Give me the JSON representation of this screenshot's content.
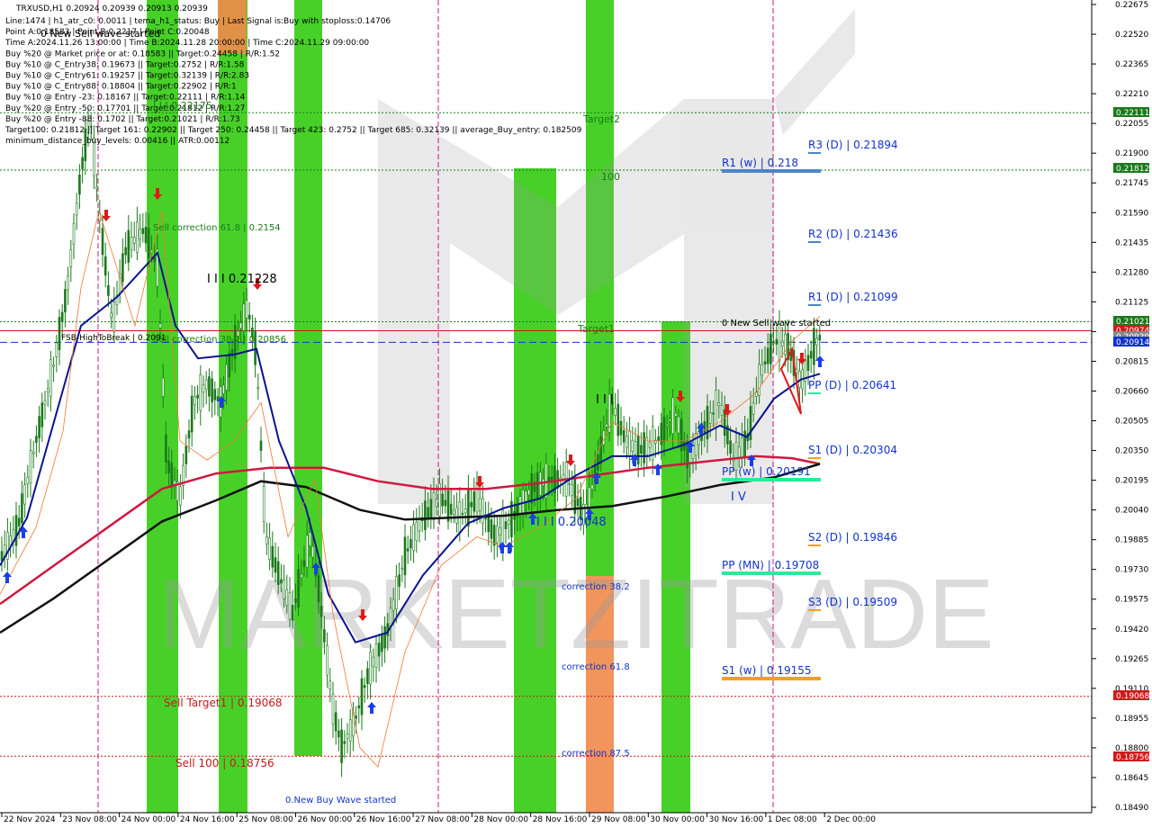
{
  "window": {
    "title": "TRXUSD,H1  0.20924 0.20939 0.20913 0.20939"
  },
  "info_lines": [
    "Line:1474 | h1_atr_c0: 0.0011 | tema_h1_status: Buy | Last Signal is:Buy with stoploss:0.14706",
    "Point A:0.18583 | Point B:0.2217 | Point C:0.20048",
    "Time A:2024.11.26 13:00:00 | Time B:2024.11.28 20:00:00 | Time C:2024.11.29 09:00:00",
    "Buy %20 @ Market price or at: 0.18583 || Target:0.24458 | R/R:1.52",
    "Buy %10 @ C_Entry38: 0.19673 || Target:0.2752 | R/R:1.58",
    "Buy %10 @ C_Entry61: 0.19257 || Target:0.32139 | R/R:2.83",
    "Buy %10 @ C_Entry88: 0.18804 || Target:0.22902 | R/R:1",
    "Buy %10 @ Entry -23: 0.18167 || Target:0.22111 | R/R:1.14",
    "Buy %20 @ Entry -50: 0.17701 || Target:0.21812 | R/R:1.27",
    "Buy %20 @ Entry -88: 0.1702 || Target:0.21021 | R/R:1.73",
    "Target100: 0.21812 || Target 161: 0.22902 || Target 250: 0.24458 || Target 423: 0.2752 || Target 685: 0.32139 || average_Buy_entry: 0.182509",
    "minimum_distance_buy_levels: 0.00416 || ATR:0.00112"
  ],
  "price_axis": {
    "ticks": [
      "0.22675",
      "0.22520",
      "0.22365",
      "0.22210",
      "0.22055",
      "0.21900",
      "0.21745",
      "0.21590",
      "0.21435",
      "0.21280",
      "0.21125",
      "0.20970",
      "0.20815",
      "0.20660",
      "0.20505",
      "0.20350",
      "0.20195",
      "0.20040",
      "0.19885",
      "0.19730",
      "0.19575",
      "0.19420",
      "0.19265",
      "0.19110",
      "0.18955",
      "0.18800",
      "0.18645",
      "0.18490"
    ],
    "boxes": [
      {
        "label": "0.22111",
        "color": "#1b7a1b"
      },
      {
        "label": "0.21812",
        "color": "#1b7a1b"
      },
      {
        "label": "0.21021",
        "color": "#1b7a1b"
      },
      {
        "label": "0.20974",
        "color": "#d11a1a"
      },
      {
        "label": "0.20939",
        "color": "#888888"
      },
      {
        "label": "0.20914",
        "color": "#1133cc"
      },
      {
        "label": "0.19068",
        "color": "#d11a1a"
      },
      {
        "label": "0.18756",
        "color": "#d11a1a"
      }
    ]
  },
  "time_axis": [
    "22 Nov 2024",
    "23 Nov 08:00",
    "24 Nov 00:00",
    "24 Nov 16:00",
    "25 Nov 08:00",
    "26 Nov 00:00",
    "26 Nov 16:00",
    "27 Nov 08:00",
    "28 Nov 00:00",
    "28 Nov 16:00",
    "29 Nov 08:00",
    "30 Nov 00:00",
    "30 Nov 16:00",
    "1 Dec 08:00",
    "2 Dec 00:00"
  ],
  "pivots": [
    {
      "label": "R3 (D) | 0.21894",
      "color": "#1133cc",
      "tick": "#4a86c8"
    },
    {
      "label": "R1 (w) | 0.218",
      "color": "#1133cc",
      "tick": "#4a86c8",
      "bold": true
    },
    {
      "label": "R2 (D) | 0.21436",
      "color": "#1133cc",
      "tick": "#4a86c8"
    },
    {
      "label": "R1 (D) | 0.21099",
      "color": "#1133cc",
      "tick": "#4a86c8"
    },
    {
      "label": "PP (D) | 0.20641",
      "color": "#1133cc",
      "tick": "#2ee89a"
    },
    {
      "label": "S1 (D) | 0.20304",
      "color": "#1133cc",
      "tick": "#f0a020"
    },
    {
      "label": "PP (w) | 0.20191",
      "color": "#1133cc",
      "tick": "#2ee89a",
      "bold": true
    },
    {
      "label": "S2 (D) | 0.19846",
      "color": "#1133cc",
      "tick": "#f0a020"
    },
    {
      "label": "PP (MN) | 0.19708",
      "color": "#1133cc",
      "tick": "#2ee89a",
      "bold": true
    },
    {
      "label": "S3 (D) | 0.19509",
      "color": "#1133cc",
      "tick": "#f0a020"
    },
    {
      "label": "S1 (w) | 0.19155",
      "color": "#1133cc",
      "tick": "#f0a020",
      "bold": true
    }
  ],
  "annotations": {
    "sell_wave_top": "0 New Sell wave started",
    "sell_wave_right": "0 New Sell wave started",
    "buy_wave": "0.New Buy Wave started",
    "sell_correction": "Sell correction 61.8 | 0.2154",
    "sell_correction_38": "Sell correction 38.2 | 0.20856",
    "level_21228": "I I I 0.21228",
    "level_22175": "I I I 0.22175",
    "level_20048": "I I I 0.20048",
    "fsb": "FSB-HighToBreak | 0.2091",
    "sell_target1": "Sell Target1 | 0.19068",
    "sell_100": "Sell 100 | 0.18756",
    "target2": "Target2",
    "t100": "100",
    "target1": "Target1",
    "corr382": "correction 38.2",
    "corr618": "correction 61.8",
    "corr875": "correction 87.5",
    "roman_mid": "I I I",
    "roman_v": "I V",
    "watermark": "MARKETZITRADE"
  },
  "colors": {
    "green_zone": "#33cc11",
    "orange_zone": "#f08a4b",
    "candle": "#1b7a1b",
    "ma_red": "#d01840",
    "ma_black": "#111111",
    "ma_navy": "#0a1490",
    "dotted_red": "#c41a1a",
    "dotted_green": "#1b7a1b",
    "dashed_blue": "#1133cc",
    "arrow_up": "#1a3ee8",
    "arrow_down": "#e01818"
  }
}
